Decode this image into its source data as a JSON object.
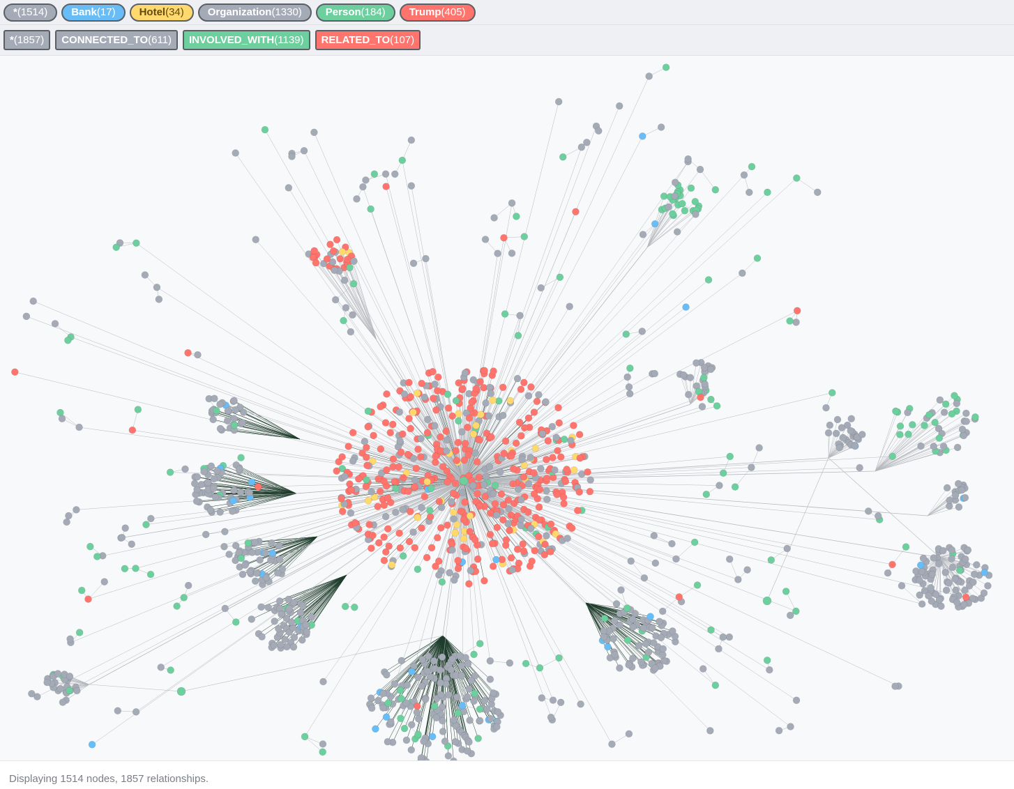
{
  "node_labels": [
    {
      "name": "*",
      "count": "(1514)",
      "color": "#a5abb6"
    },
    {
      "name": "Bank",
      "count": "(17)",
      "color": "#68bdf6"
    },
    {
      "name": "Hotel",
      "count": "(34)",
      "color": "#ffd86e",
      "text_color": "#604a0e"
    },
    {
      "name": "Organization",
      "count": "(1330)",
      "color": "#a5abb6"
    },
    {
      "name": "Person",
      "count": "(184)",
      "color": "#6dce9e"
    },
    {
      "name": "Trump",
      "count": "(405)",
      "color": "#ff756e"
    }
  ],
  "relationship_types": [
    {
      "name": "*",
      "count": "(1857)",
      "color": "#a5abb6"
    },
    {
      "name": "CONNECTED_TO",
      "count": "(611)",
      "color": "#a5abb6"
    },
    {
      "name": "INVOLVED_WITH",
      "count": "(1139)",
      "color": "#6dce9e"
    },
    {
      "name": "RELATED_TO",
      "count": "(107)",
      "color": "#ff756e"
    }
  ],
  "status": {
    "text": "Displaying 1514 nodes, 1857 relationships."
  },
  "colors": {
    "organization": "#a5abb6",
    "person": "#6dce9e",
    "trump": "#ff756e",
    "hotel": "#ffd86e",
    "bank": "#68bdf6",
    "edge": "#b5b8bd",
    "edge_dark": "#1f3d2c"
  }
}
